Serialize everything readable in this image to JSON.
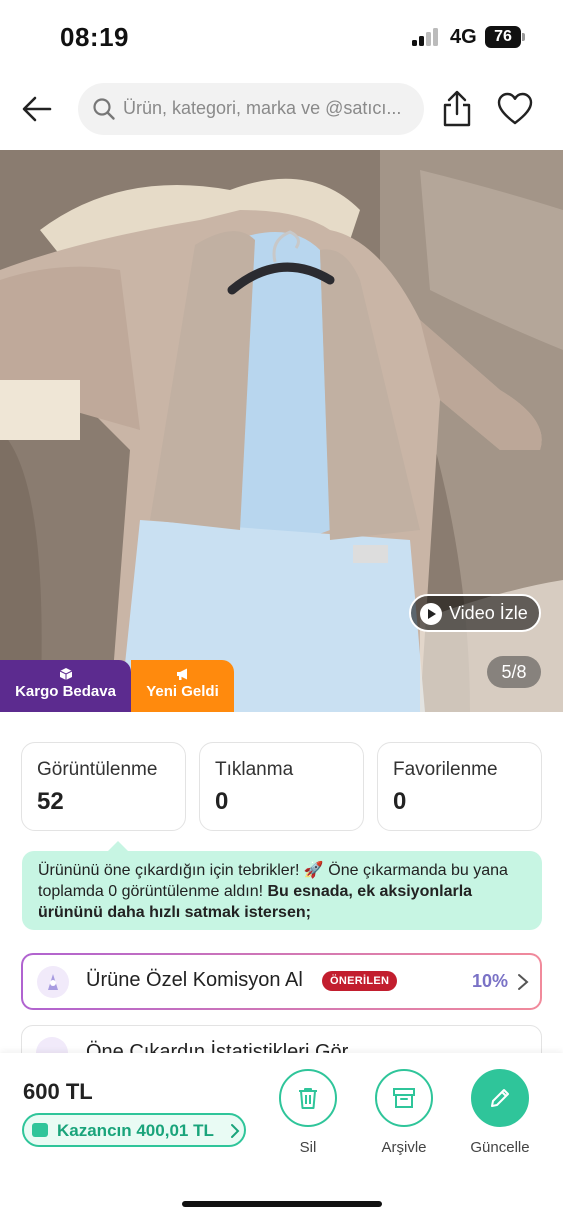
{
  "status_bar": {
    "time": "08:19",
    "network": "4G",
    "battery": "76"
  },
  "header": {
    "search_placeholder": "Ürün, kategori, marka ve @satıcı...",
    "icons": [
      "back-arrow-icon",
      "search-icon",
      "share-icon",
      "heart-icon"
    ]
  },
  "product_image": {
    "video_label": "Video İzle",
    "counter": "5/8",
    "badges": [
      {
        "label": "Kargo Bedava",
        "icon": "box-icon",
        "color": "#5c2b8f"
      },
      {
        "label": "Yeni Geldi",
        "icon": "megaphone-icon",
        "color": "#ff8a0d"
      }
    ]
  },
  "stats": [
    {
      "label": "Görüntülenme",
      "value": "52"
    },
    {
      "label": "Tıklanma",
      "value": "0"
    },
    {
      "label": "Favorilenme",
      "value": "0"
    }
  ],
  "info": {
    "text": "Ürününü öne çıkardığın için tebrikler! 🚀 Öne çıkarmanda bu yana toplamda 0 görüntülenme aldın! ",
    "bold": "Bu esnada, ek aksiyonlarla ürününü daha hızlı satmak istersen;"
  },
  "actions": [
    {
      "label": "Ürüne Özel Komisyon Al",
      "badge": "ÖNERİLEN",
      "value": "10%"
    },
    {
      "label": "Öne Çıkardın İstatistikleri Gör"
    }
  ],
  "bottom": {
    "price": "600 TL",
    "earnings": "Kazancın 400,01 TL",
    "buttons": [
      {
        "label": "Sil",
        "icon": "trash-icon"
      },
      {
        "label": "Arşivle",
        "icon": "archive-icon"
      },
      {
        "label": "Güncelle",
        "icon": "pencil-icon"
      }
    ]
  },
  "colors": {
    "accent_green": "#2fc59a",
    "info_bg": "#c7f5e3",
    "badge_red": "#c21e2e",
    "purple": "#5c2b8f",
    "orange": "#ff8a0d"
  }
}
